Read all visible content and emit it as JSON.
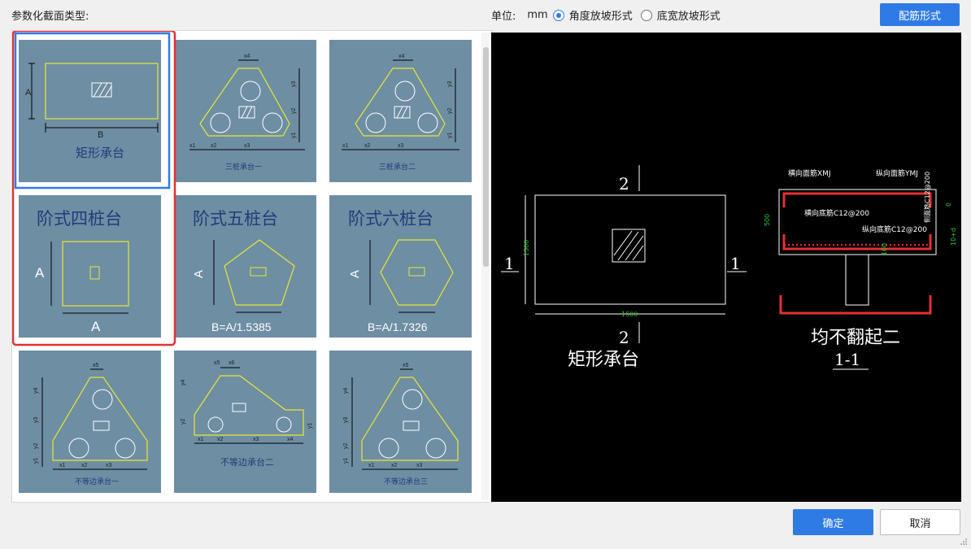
{
  "header": {
    "section_label": "参数化截面类型:",
    "unit_label": "单位:",
    "unit_value": "mm",
    "radio_angle": "角度放坡形式",
    "radio_width": "底宽放坡形式",
    "rebar_button": "配筋形式"
  },
  "thumbnails": [
    {
      "title": "矩形承台",
      "dims": {
        "a": "A",
        "b": "B"
      }
    },
    {
      "title": "三桩承台一",
      "dims": {
        "x4": "x4",
        "y3": "y3",
        "y2": "y2",
        "y1": "y1",
        "x1": "x1",
        "x2": "x2",
        "x3": "x3"
      }
    },
    {
      "title": "三桩承台二",
      "dims": {
        "x4": "x4",
        "y3": "y3",
        "y2": "y2",
        "y1": "y1",
        "x1": "x1",
        "x2": "x2",
        "x3": "x3"
      }
    },
    {
      "title": "阶式四桩台",
      "dims": {
        "a": "A",
        "a2": "A"
      }
    },
    {
      "title": "阶式五桩台",
      "dims": {
        "a": "A",
        "formula": "B=A/1.5385"
      }
    },
    {
      "title": "阶式六桩台",
      "dims": {
        "a": "A",
        "formula": "B=A/1.7326"
      }
    },
    {
      "title": "不等边承台一",
      "dims": {
        "x5": "x5",
        "y4": "y4",
        "y3": "y3",
        "y2": "y2",
        "y1": "y1",
        "x1": "x1",
        "x2": "x2",
        "x3": "x3"
      }
    },
    {
      "title": "不等边承台二",
      "dims": {
        "x5": "x5",
        "x6": "x6",
        "y4": "y4",
        "y1": "y1",
        "y2": "y2",
        "x1": "x1",
        "x2": "x2",
        "x3": "x3",
        "x4": "x4"
      }
    },
    {
      "title": "不等边承台三",
      "dims": {
        "x5": "x5",
        "y4": "y4",
        "y3": "y3",
        "y2": "y2",
        "y1": "y1",
        "x1": "x1",
        "x2": "x2",
        "x3": "x3"
      }
    }
  ],
  "preview": {
    "section_mark_top": "2",
    "section_mark_bottom": "2",
    "section_mark_left": "1",
    "section_mark_right": "1",
    "dim_height": "1500",
    "dim_width": "1500",
    "plan_title": "矩形承台",
    "label_top_bar": "横向面筋XMJ",
    "label_long_top": "纵向面筋YMJ",
    "label_bottom_bar": "横向底筋C12@200",
    "label_long_bottom": "纵向底筋C12@200",
    "label_side": "侧面筋C12@200",
    "label_height": "500",
    "label_100": "100",
    "label_0": "0",
    "label_10d": "10+d",
    "section_caption": "均不翻起二",
    "section_name": "1-1"
  },
  "footer": {
    "ok_button": "确定",
    "cancel_button": "取消"
  },
  "colors": {
    "accent": "#2f7be5",
    "thumb_bg": "#6e8ea3",
    "outline_yellow": "#e8e832",
    "selection_red": "#e53030",
    "selection_blue": "#2f7be5"
  }
}
